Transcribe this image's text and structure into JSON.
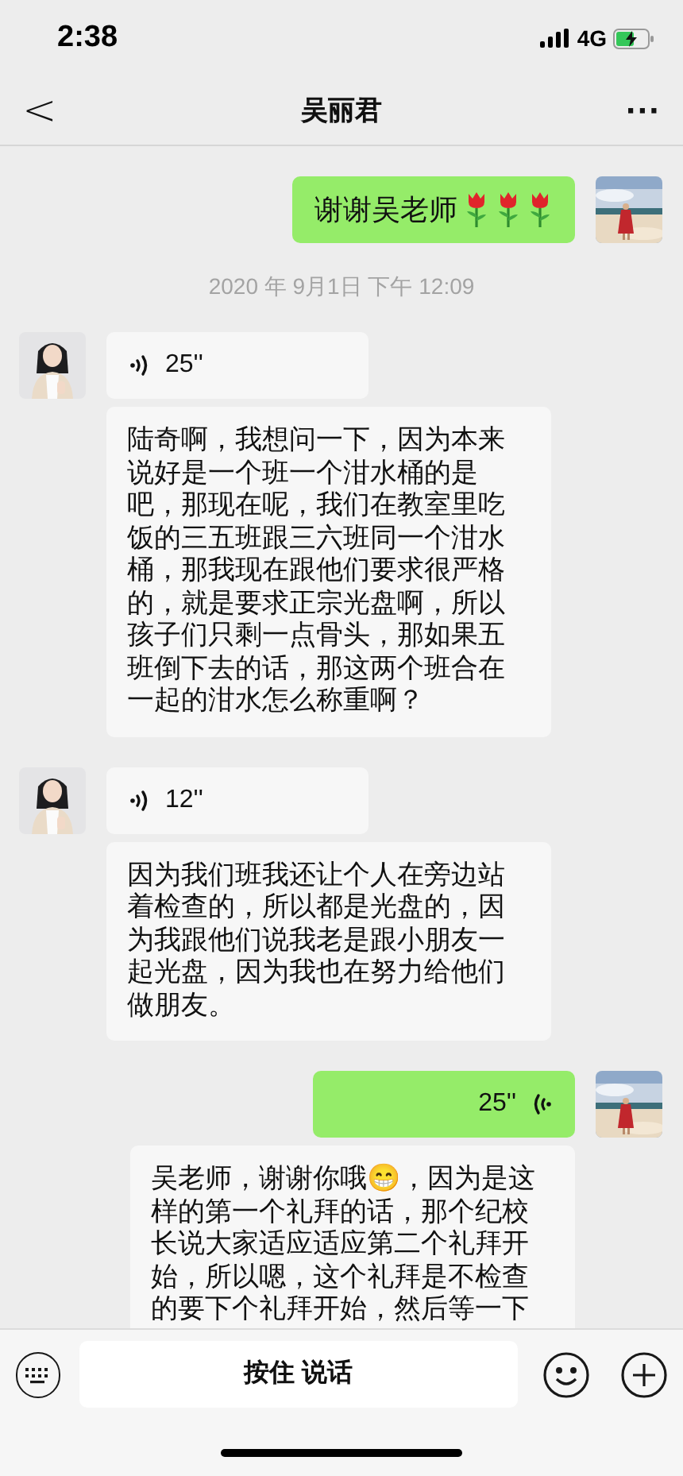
{
  "status_bar": {
    "time": "2:38",
    "network": "4G"
  },
  "header": {
    "back": "<",
    "title": "吴丽君",
    "more": "···"
  },
  "messages": [
    {
      "kind": "text_with_roses",
      "outgoing": true,
      "text": "谢谢吴老师"
    },
    {
      "kind": "time",
      "text": "2020 年 9月1日 下午 12:09"
    },
    {
      "kind": "voice",
      "outgoing": false,
      "duration": "25''",
      "transcription": "陆奇啊，我想问一下，因为本来说好是一个班一个泔水桶的是吧，那现在呢，我们在教室里吃饭的三五班跟三六班同一个泔水桶，那我现在跟他们要求很严格的，就是要求正宗光盘啊，所以孩子们只剩一点骨头，那如果五班倒下去的话，那这两个班合在一起的泔水怎么称重啊？"
    },
    {
      "kind": "voice",
      "outgoing": false,
      "duration": "12''",
      "transcription": "因为我们班我还让个人在旁边站着检查的，所以都是光盘的，因为我跟他们说我老是跟小朋友一起光盘，因为我也在努力给他们做朋友。"
    },
    {
      "kind": "voice",
      "outgoing": true,
      "duration": "25''",
      "transcription": "吴老师，谢谢你哦😁，因为是这样的第一个礼拜的话，那个纪校长说大家适应适应第二个礼拜开始，所以嗯，这个礼拜是不检查的要下个礼拜开始，然后等一下"
    }
  ],
  "input_bar": {
    "hold_to_talk": "按住 说话"
  }
}
